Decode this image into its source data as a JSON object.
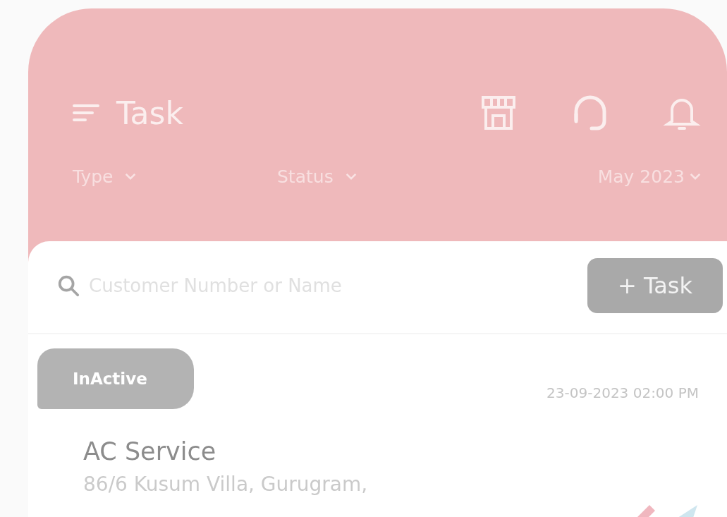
{
  "header": {
    "title": "Task"
  },
  "filters": [
    {
      "label": "Type"
    },
    {
      "label": "Status"
    },
    {
      "label": "May 2023"
    }
  ],
  "search": {
    "placeholder": "Customer Number or Name"
  },
  "add_button": {
    "label": "+ Task"
  },
  "tasks": [
    {
      "status": "InActive",
      "datetime": "23-09-2023  02:00 PM",
      "title": "AC Service",
      "address": "86/6 Kusum Villa, Gurugram,"
    }
  ]
}
